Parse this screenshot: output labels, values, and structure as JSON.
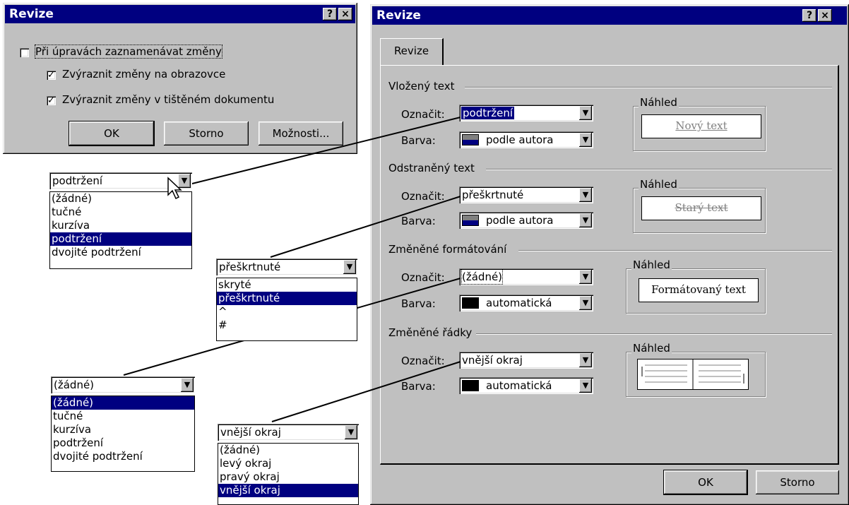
{
  "small_dialog": {
    "title": "Revize",
    "help_button": "?",
    "close_button": "×",
    "track_changes_label": "Při úpravách zaznamenávat změny",
    "highlight_screen_label": "Zvýraznit změny na obrazovce",
    "highlight_print_label": "Zvýraznit změny v tištěném dokumentu",
    "ok": "OK",
    "cancel": "Storno",
    "options": "Možnosti..."
  },
  "callouts": {
    "underline_combo": "podtržení",
    "underline_list": [
      "(žádné)",
      "tučné",
      "kurzíva",
      "podtržení",
      "dvojité podtržení"
    ],
    "strike_combo": "přeškrtnuté",
    "strike_list": [
      "skryté",
      "přeškrtnuté",
      "^",
      "#"
    ],
    "none_combo": "(žádné)",
    "none_list": [
      "(žádné)",
      "tučné",
      "kurzíva",
      "podtržení",
      "dvojité podtržení"
    ],
    "border_combo": "vnější okraj",
    "border_list": [
      "(žádné)",
      "levý okraj",
      "pravý okraj",
      "vnější okraj"
    ]
  },
  "big_dialog": {
    "title": "Revize",
    "help_button": "?",
    "close_button": "×",
    "tab": "Revize",
    "mark_label": "Označit:",
    "color_label": "Barva:",
    "preview_label": "Náhled",
    "inserted": {
      "heading": "Vložený text",
      "mark": "podtržení",
      "color": "podle autora",
      "preview": "Nový text"
    },
    "deleted": {
      "heading": "Odstraněný text",
      "mark": "přeškrtnuté",
      "color": "podle autora",
      "preview": "Starý text"
    },
    "formatting": {
      "heading": "Změněné formátování",
      "mark": "(žádné)",
      "color": "automatická",
      "preview": "Formátovaný text"
    },
    "lines": {
      "heading": "Změněné řádky",
      "mark": "vnější okraj",
      "color": "automatická"
    },
    "ok": "OK",
    "cancel": "Storno"
  },
  "colors": {
    "title_bar": "#000080",
    "face": "#c0c0c0",
    "author_swatch": "#000080",
    "preview_gray": "#808080"
  }
}
